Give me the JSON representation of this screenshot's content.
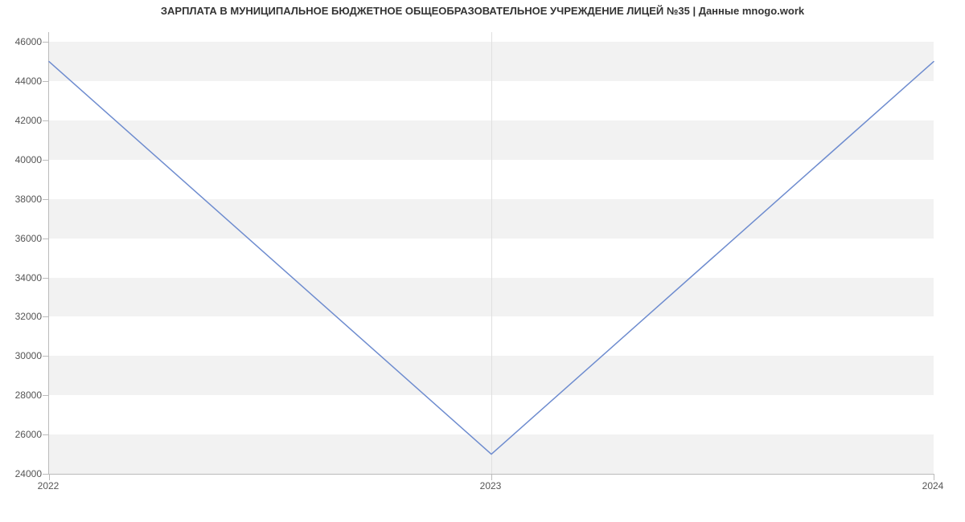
{
  "chart_data": {
    "type": "line",
    "title": "ЗАРПЛАТА В МУНИЦИПАЛЬНОЕ БЮДЖЕТНОЕ ОБЩЕОБРАЗОВАТЕЛЬНОЕ УЧРЕЖДЕНИЕ ЛИЦЕЙ №35 | Данные mnogo.work",
    "xlabel": "",
    "ylabel": "",
    "categories": [
      "2022",
      "2023",
      "2024"
    ],
    "values": [
      45000,
      25000,
      45000
    ],
    "y_ticks": [
      24000,
      26000,
      28000,
      30000,
      32000,
      34000,
      36000,
      38000,
      40000,
      42000,
      44000,
      46000
    ],
    "ylim": [
      24000,
      46500
    ],
    "line_color": "#6e8ccf",
    "band_color": "#f2f2f2"
  }
}
